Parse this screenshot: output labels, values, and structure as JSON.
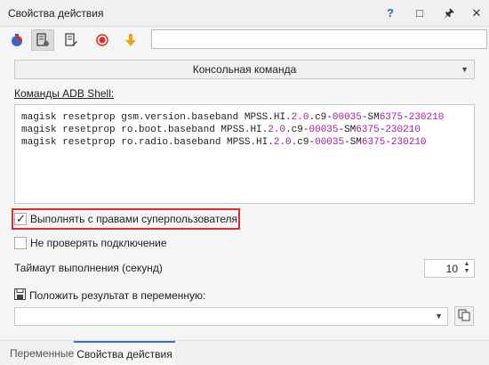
{
  "window": {
    "title": "Свойства действия"
  },
  "title_icons": [
    "help-icon",
    "minimize-icon",
    "pin-icon",
    "close-icon"
  ],
  "toolbar": {
    "icons": [
      "test-run-icon",
      "action-settings-icon",
      "edit-icon",
      "record-icon",
      "arrow-down-icon"
    ],
    "input_value": ""
  },
  "action_type": "Консольная команда",
  "commands": {
    "label": "Команды ADB Shell:",
    "lines": [
      {
        "pre": "magisk resetprop gsm.version.baseband MPSS.HI.",
        "n1": "2.0",
        "mid": ".c9-",
        "n2": "00035",
        "mid2": "-SM",
        "n3": "6375",
        "mid3": "-",
        "n4": "230210"
      },
      {
        "pre": "magisk resetprop ro.boot.baseband MPSS.HI.",
        "n1": "2.0",
        "mid": ".c9-",
        "n2": "00035",
        "mid2": "-SM",
        "n3": "6375",
        "mid3": "-",
        "n4": "230210"
      },
      {
        "pre": "magisk resetprop ro.radio.baseband MPSS.HI.",
        "n1": "2.0",
        "mid": ".c9-",
        "n2": "00035",
        "mid2": "-SM",
        "n3": "6375",
        "mid3": "-",
        "n4": "230210"
      }
    ]
  },
  "options": {
    "superuser": {
      "label": "Выполнять с правами суперпользователя",
      "checked": true
    },
    "no_check": {
      "label": "Не проверять подключение",
      "checked": false
    }
  },
  "timeout": {
    "label": "Таймаут выполнения (секунд)",
    "value": "10"
  },
  "result": {
    "label": "Положить результат в переменную:",
    "value": ""
  },
  "tabs": [
    {
      "label": "Переменные",
      "active": false
    },
    {
      "label": "Свойства действия",
      "active": true
    }
  ],
  "colors": {
    "accent": "#2f6fd6",
    "highlight": "#d32f2f",
    "numeric": "#a31aa3",
    "record": "#e0292b",
    "arrow": "#f2a31a"
  }
}
